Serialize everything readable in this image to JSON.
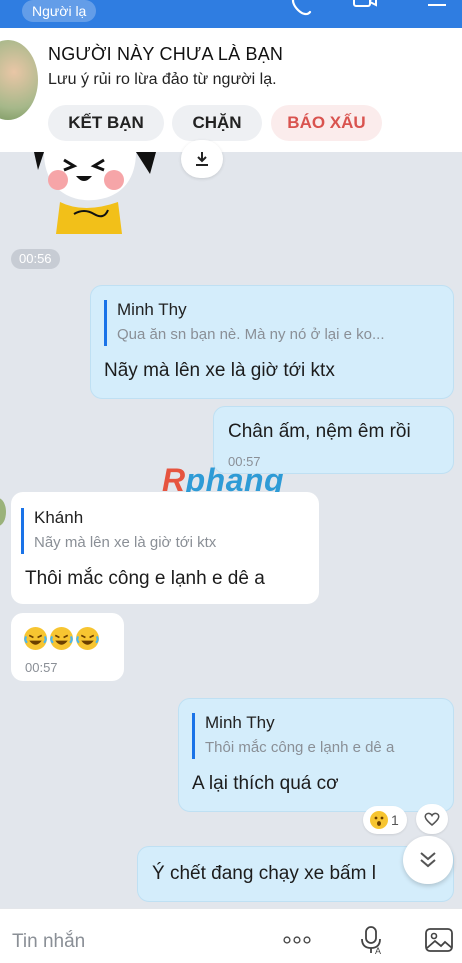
{
  "header": {
    "stranger_badge": "Người lạ"
  },
  "banner": {
    "title": "NGƯỜI NÀY CHƯA LÀ BẠN",
    "note": "Lưu ý rủi ro lừa đảo từ người lạ.",
    "add_friend": "KẾT BẠN",
    "block": "CHẶN",
    "report": "BÁO XẤU"
  },
  "chat": {
    "sticker_time": "00:56",
    "m1": {
      "quote_name": "Minh Thy",
      "quote_text": "Qua ăn sn bạn nè. Mà ny nó ở lại e ko...",
      "text": "Nãy mà lên xe là giờ tới ktx"
    },
    "m2": {
      "text": "Chân ấm, nệm êm rồi",
      "time": "00:57"
    },
    "m3": {
      "quote_name": "Khánh",
      "quote_text": "Nãy mà lên xe là giờ tới ktx",
      "text": "Thôi mắc công e lạnh e dê a"
    },
    "m4": {
      "time": "00:57"
    },
    "m5": {
      "quote_name": "Minh Thy",
      "quote_text": "Thôi mắc công e lạnh e dê a",
      "text": "A lại thích quá cơ"
    },
    "reaction_count": "1",
    "m6": {
      "text": "Ý chết đang chạy xe bấm l"
    }
  },
  "watermark": {
    "r": "R",
    "rest": "phang"
  },
  "input": {
    "placeholder": "Tin nhắn"
  }
}
